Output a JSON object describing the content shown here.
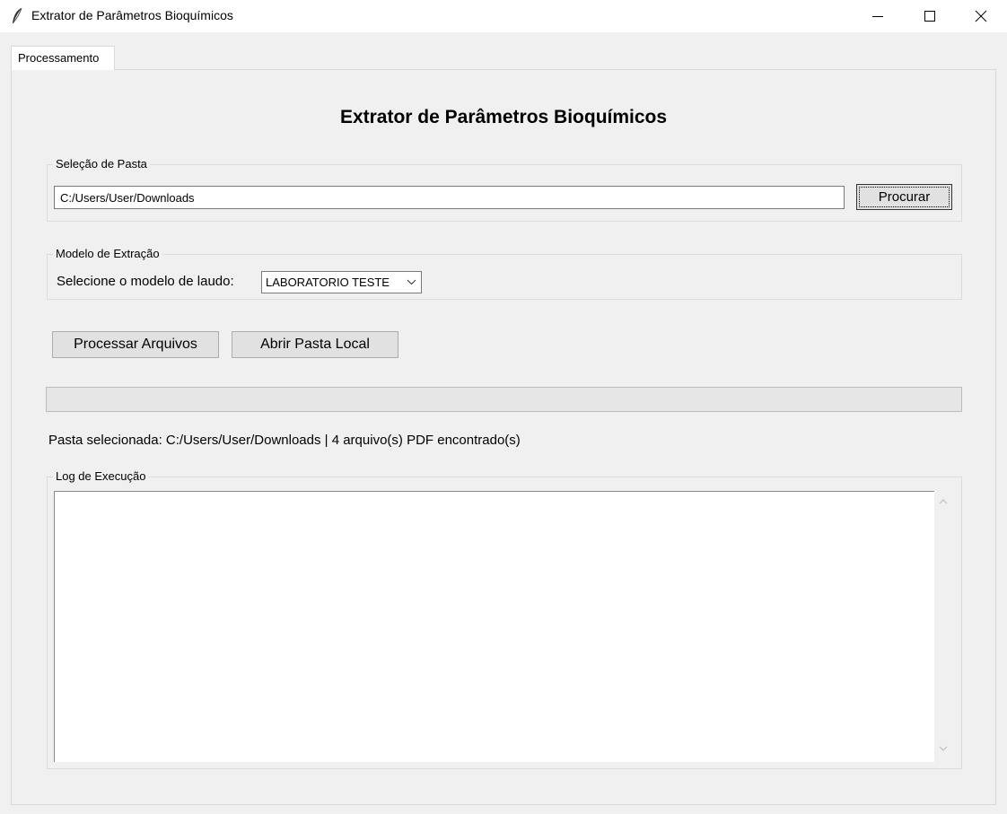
{
  "window": {
    "title": "Extrator de Parâmetros Bioquímicos"
  },
  "tabs": [
    {
      "label": "Processamento",
      "active": true
    }
  ],
  "main": {
    "heading": "Extrator de Parâmetros Bioquímicos",
    "folder_group": {
      "label": "Seleção de Pasta",
      "path_value": "C:/Users/User/Downloads",
      "browse_label": "Procurar"
    },
    "model_group": {
      "label": "Modelo de Extração",
      "select_label": "Selecione o modelo de laudo:",
      "selected_model": "LABORATORIO TESTE"
    },
    "actions": {
      "process_label": "Processar Arquivos",
      "open_folder_label": "Abrir Pasta Local"
    },
    "progress": {
      "value": 0
    },
    "status_text": "Pasta selecionada: C:/Users/User/Downloads | 4 arquivo(s) PDF encontrado(s)",
    "log_group": {
      "label": "Log de Execução",
      "content": ""
    }
  },
  "icons": {
    "app": "feather-icon",
    "minimize": "minimize-icon",
    "maximize": "maximize-icon",
    "close": "close-icon",
    "dropdown": "chevron-down-icon",
    "scroll_up": "chevron-up-icon",
    "scroll_down": "chevron-down-icon"
  },
  "colors": {
    "window_bg": "#f0f0f0",
    "button_bg": "#e1e1e1",
    "titlebar_bg": "#ffffff"
  }
}
